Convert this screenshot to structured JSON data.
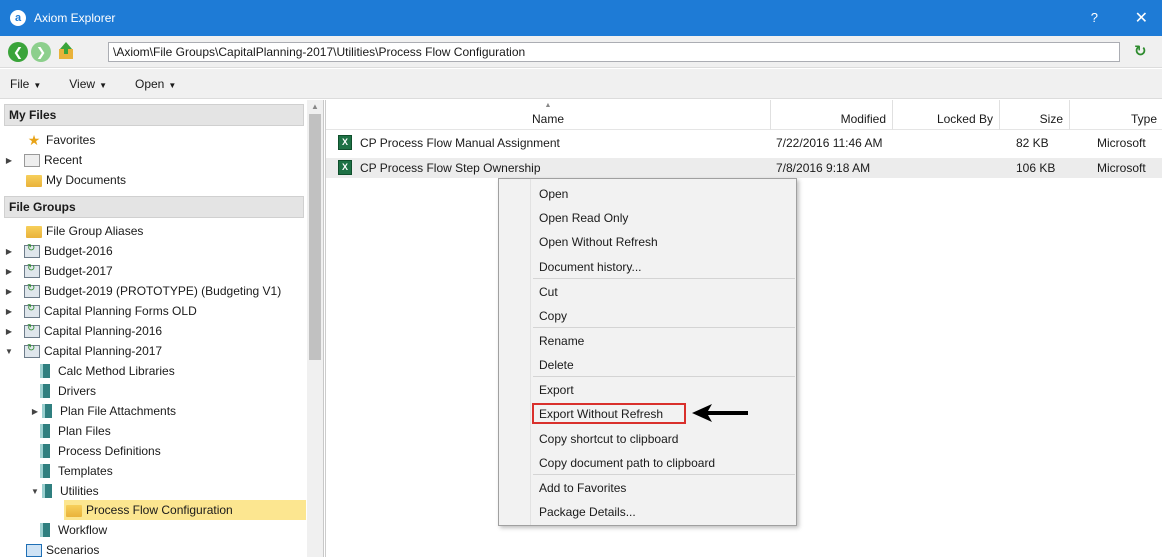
{
  "window": {
    "title": "Axiom Explorer",
    "app_icon": "a",
    "help": "?",
    "close": "✕"
  },
  "address": {
    "path": "\\Axiom\\File Groups\\CapitalPlanning-2017\\Utilities\\Process Flow Configuration"
  },
  "menu": {
    "file": "File",
    "view": "View",
    "open": "Open"
  },
  "sections": {
    "my_files": "My Files",
    "file_groups": "File Groups"
  },
  "my_files": [
    {
      "label": "Favorites",
      "icon": "star-icon"
    },
    {
      "label": "Recent",
      "icon": "recent-icon"
    },
    {
      "label": "My Documents",
      "icon": "folder-icon"
    }
  ],
  "file_groups": [
    {
      "label": "File Group Aliases",
      "icon": "folder"
    },
    {
      "label": "Budget-2016",
      "icon": "filegroup"
    },
    {
      "label": "Budget-2017",
      "icon": "filegroup"
    },
    {
      "label": "Budget-2019 (PROTOTYPE) (Budgeting V1)",
      "icon": "filegroup"
    },
    {
      "label": "Capital Planning Forms OLD",
      "icon": "filegroup"
    },
    {
      "label": "Capital Planning-2016",
      "icon": "filegroup"
    },
    {
      "label": "Capital Planning-2017",
      "icon": "filegroup"
    },
    {
      "label": "Calc Method Libraries",
      "icon": "library"
    },
    {
      "label": "Drivers",
      "icon": "library"
    },
    {
      "label": "Plan File Attachments",
      "icon": "library"
    },
    {
      "label": "Plan Files",
      "icon": "library"
    },
    {
      "label": "Process Definitions",
      "icon": "library"
    },
    {
      "label": "Templates",
      "icon": "library"
    },
    {
      "label": "Utilities",
      "icon": "library"
    },
    {
      "label": "Process Flow Configuration",
      "icon": "folder"
    },
    {
      "label": "Workflow",
      "icon": "library"
    },
    {
      "label": "Scenarios",
      "icon": "scenarios"
    }
  ],
  "columns": {
    "name": "Name",
    "modified": "Modified",
    "locked_by": "Locked By",
    "size": "Size",
    "type": "Type"
  },
  "files": [
    {
      "name": "CP Process Flow Manual Assignment",
      "modified": "7/22/2016 11:46 AM",
      "locked_by": "",
      "size": "82 KB",
      "type": "Microsoft"
    },
    {
      "name": "CP Process Flow Step Ownership",
      "modified": "7/8/2016 9:18 AM",
      "locked_by": "",
      "size": "106 KB",
      "type": "Microsoft"
    }
  ],
  "context_menu": [
    "Open",
    "Open Read Only",
    "Open Without Refresh",
    "Document history...",
    "Cut",
    "Copy",
    "Rename",
    "Delete",
    "Export",
    "Export Without Refresh",
    "Copy shortcut to clipboard",
    "Copy document path to clipboard",
    "Add to Favorites",
    "Package Details..."
  ],
  "colors": {
    "titlebar": "#1e7bd6",
    "selected": "#fce690",
    "highlight_box": "#d9302c"
  }
}
